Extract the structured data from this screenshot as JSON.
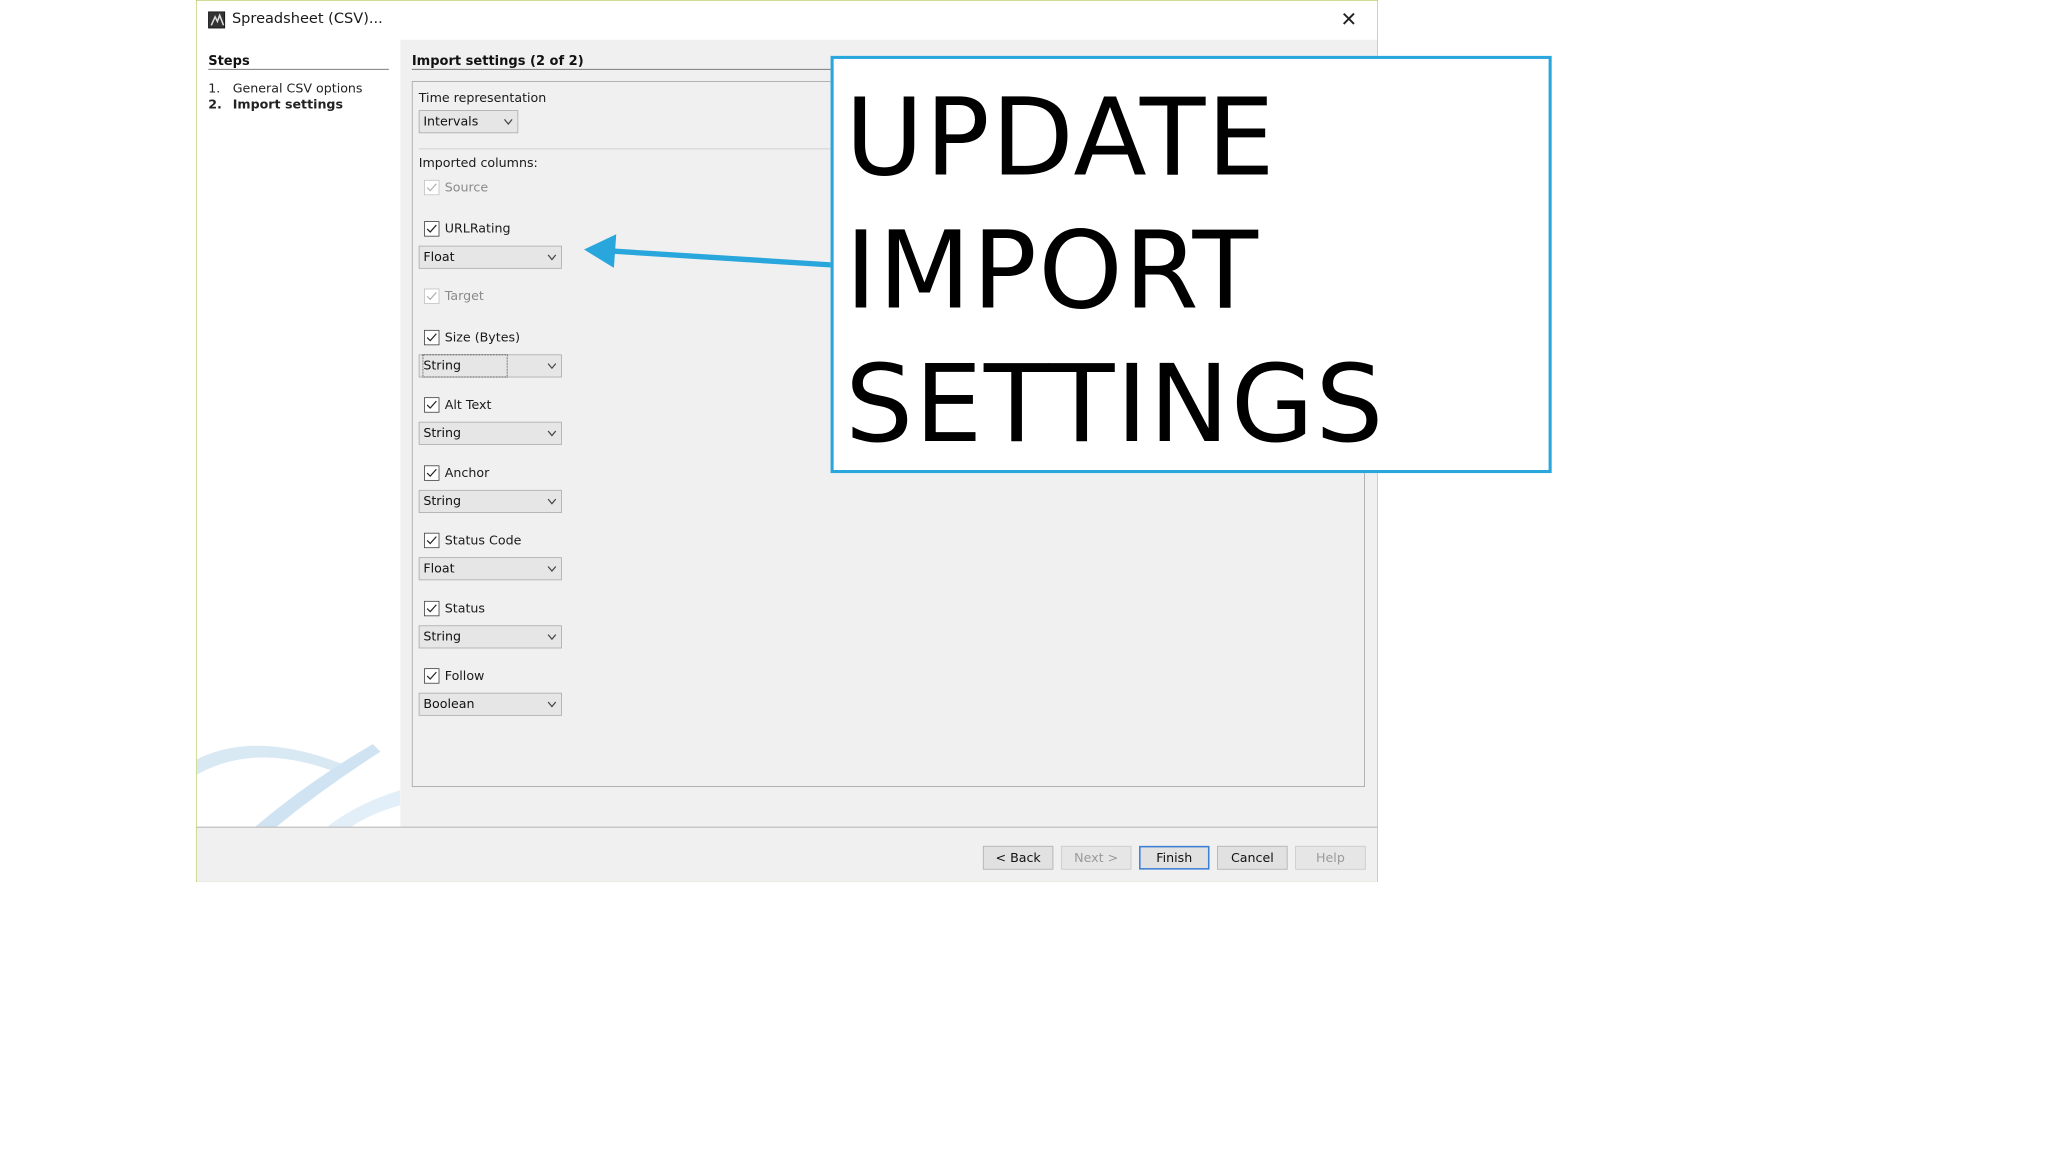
{
  "window": {
    "title": "Spreadsheet (CSV)...",
    "close_label": "✕"
  },
  "steps": {
    "heading": "Steps",
    "items": [
      {
        "num": "1.",
        "label": "General CSV options"
      },
      {
        "num": "2.",
        "label": "Import settings",
        "current": true
      }
    ]
  },
  "main": {
    "heading": "Import settings (2 of 2)",
    "time_representation": {
      "label": "Time representation",
      "value": "Intervals"
    },
    "imported_columns_label": "Imported columns:",
    "columns": [
      {
        "name": "Source",
        "checked": true,
        "enabled": false
      },
      {
        "name": "URLRating",
        "checked": true,
        "enabled": true,
        "type": "Float"
      },
      {
        "name": "Target",
        "checked": true,
        "enabled": false
      },
      {
        "name": "Size (Bytes)",
        "checked": true,
        "enabled": true,
        "type": "String",
        "focused": true
      },
      {
        "name": "Alt Text",
        "checked": true,
        "enabled": true,
        "type": "String"
      },
      {
        "name": "Anchor",
        "checked": true,
        "enabled": true,
        "type": "String"
      },
      {
        "name": "Status Code",
        "checked": true,
        "enabled": true,
        "type": "Float"
      },
      {
        "name": "Status",
        "checked": true,
        "enabled": true,
        "type": "String"
      },
      {
        "name": "Follow",
        "checked": true,
        "enabled": true,
        "type": "Boolean"
      }
    ]
  },
  "footer": {
    "back": "< Back",
    "next": "Next >",
    "finish": "Finish",
    "cancel": "Cancel",
    "help": "Help"
  },
  "callout": {
    "lines": [
      "UPDATE",
      "IMPORT",
      "SETTINGS"
    ],
    "border_color": "#29a6dc",
    "arrow_color": "#29a6dc"
  }
}
